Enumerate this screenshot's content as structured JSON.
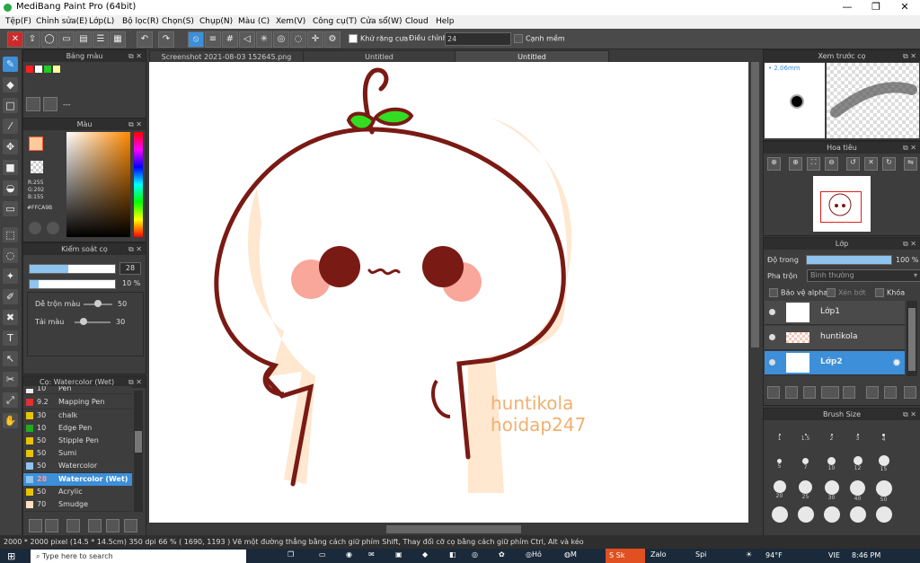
{
  "window": {
    "title": "MediBang Paint Pro (64bit)",
    "controls": {
      "minimize": "—",
      "maximize": "❐",
      "close": "✕"
    }
  },
  "menu": [
    "Tệp(F)",
    "Chỉnh sửa(E)",
    "Lớp(L)",
    "Bộ lọc(R)",
    "Chọn(S)",
    "Chụp(N)",
    "Màu (C)",
    "Xem(V)",
    "Công cụ(T)",
    "Cửa sổ(W)",
    "Cloud",
    "Help"
  ],
  "toolbar": {
    "antialias_label": "Khử răng cưa",
    "adjust_label": "Điều chỉnh",
    "adjust_value": "24",
    "snap_label": "Cạnh mềm"
  },
  "palette_panel": {
    "title": "Bảng màu",
    "value": "---",
    "swatches": [
      "#ff2020",
      "#ffffff",
      "#22cc22",
      "#ffff99"
    ]
  },
  "color_panel": {
    "title": "Màu",
    "r": "R:255",
    "g": "G:202",
    "b": "B:155",
    "hex": "#FFCA9B",
    "fg_color": "#ffca9b",
    "bg_color": "#ffffff"
  },
  "brush_control": {
    "title": "Kiểm soát cọ",
    "size": "28",
    "size_fraction": 0.45,
    "opacity": "10 %",
    "opacity_fraction": 0.1,
    "blend_label": "Dễ trộn màu",
    "blend_value": "50",
    "load_label": "Tải màu",
    "load_value": "30"
  },
  "brush_list": {
    "title": "Cọ: Watercolor (Wet)",
    "items": [
      {
        "size": "10",
        "name": "Pen",
        "color": "#eeeeee"
      },
      {
        "size": "9.2",
        "name": "Mapping Pen",
        "color": "#e03030"
      },
      {
        "size": "30",
        "name": "chalk",
        "color": "#e8c400"
      },
      {
        "size": "10",
        "name": "Edge Pen",
        "color": "#22aa22"
      },
      {
        "size": "50",
        "name": "Stipple Pen",
        "color": "#e8c400"
      },
      {
        "size": "50",
        "name": "Sumi",
        "color": "#e8c400"
      },
      {
        "size": "50",
        "name": "Watercolor",
        "color": "#8ec4ee"
      },
      {
        "size": "28",
        "name": "Watercolor (Wet)",
        "color": "#8ec4ee"
      },
      {
        "size": "50",
        "name": "Acrylic",
        "color": "#e8c400"
      },
      {
        "size": "70",
        "name": "Smudge",
        "color": "#ffe0c0"
      }
    ]
  },
  "tabs": [
    "Screenshot 2021-08-03 152645.png",
    "Untitled",
    "Untitled"
  ],
  "canvas": {
    "text_line1": "huntikola",
    "text_line2": "hoidap247"
  },
  "preview_panel": {
    "title": "Xem trước cọ",
    "size": "• 2.06mm"
  },
  "navigator_panel": {
    "title": "Hoa tiêu"
  },
  "layer_panel": {
    "title": "Lớp",
    "opacity_label": "Độ trong",
    "opacity_value": "100 %",
    "opacity_fraction": 1.0,
    "blend_label": "Pha trộn",
    "blend_value": "Bình thường",
    "protect_alpha": "Bảo vệ alpha",
    "clip": "Xén bớt",
    "lock": "Khóa",
    "layers": [
      "Lớp1",
      "huntikola",
      "Lớp2"
    ]
  },
  "brush_size_panel": {
    "title": "Brush Size",
    "sizes": [
      "1",
      "1.5",
      "2",
      "3",
      "4",
      "5",
      "7",
      "10",
      "12",
      "15",
      "20",
      "25",
      "30",
      "40",
      "50"
    ]
  },
  "status": {
    "text": "2000 * 2000 pixel  (14.5 * 14.5cm)  350 dpi  66 %  ( 1690, 1193 )  Vẽ một đường thẳng bằng cách giữ phím Shift, Thay đổi cỡ cọ bằng cách giữ phím Ctrl, Alt và kéo"
  },
  "taskbar": {
    "search": "Type here to search",
    "time": "8:46 PM",
    "temp": "94°F",
    "lang": "VIE",
    "apps": [
      "M",
      "Sk",
      "Zalo",
      "Spi",
      "Hỏ"
    ]
  }
}
